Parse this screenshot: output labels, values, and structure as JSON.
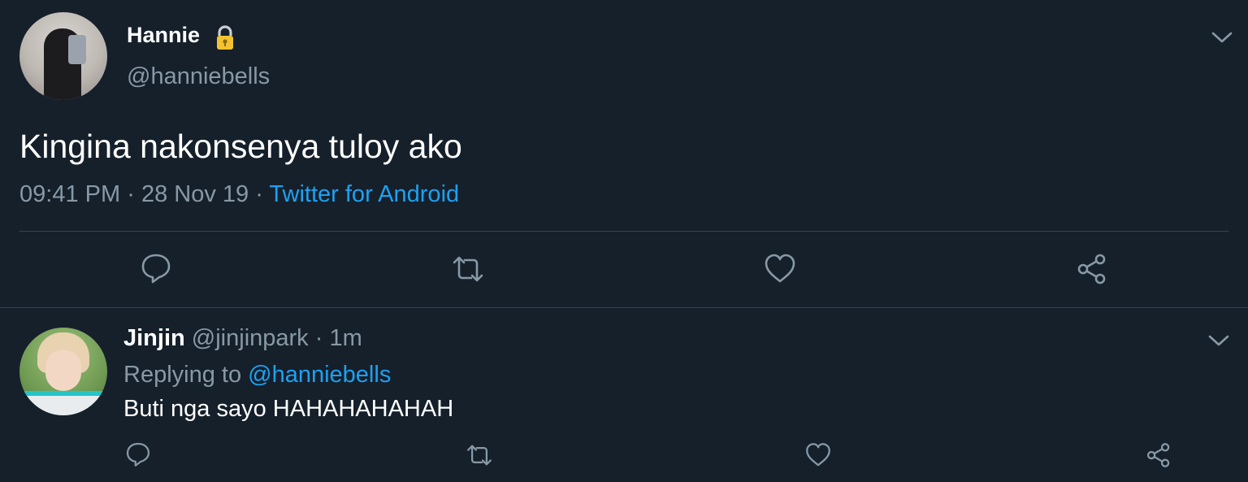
{
  "tweet": {
    "author_name": "Hannie",
    "author_handle": "@hanniebells",
    "text": "Kingina nakonsenya tuloy ako",
    "time": "09:41 PM",
    "date": "28 Nov 19",
    "separator": "·",
    "source": "Twitter for Android",
    "icons": {
      "protected": "lock-icon",
      "menu": "chevron-down-icon",
      "reply": "reply-icon",
      "retweet": "retweet-icon",
      "like": "heart-icon",
      "share": "share-icon"
    }
  },
  "reply": {
    "author_name": "Jinjin",
    "author_handle": "@jinjinpark",
    "separator": "·",
    "age": "1m",
    "replying_label": "Replying to",
    "replying_mention": "@hanniebells",
    "text": "Buti nga sayo HAHAHAHAHAH"
  },
  "colors": {
    "background": "#15202b",
    "secondary_text": "#8899a6",
    "link": "#1da1f2",
    "divider": "#38444d"
  }
}
